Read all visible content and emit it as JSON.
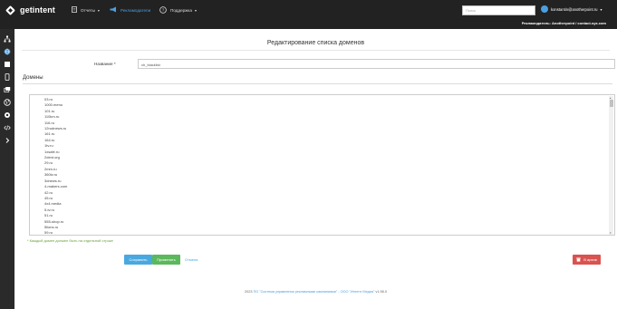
{
  "header": {
    "logo_text": "getintent",
    "nav": {
      "reports": "Отчеты",
      "advertisers": "Рекламодатели",
      "support": "Поддержка"
    },
    "search_placeholder": "Поиск",
    "user_email": "konstantin@anotherpoint.ru"
  },
  "subheader": {
    "advertiser_text": "Рекламодатель: Anotherpoint / contact-sys.com"
  },
  "sidebar": {
    "icons": [
      "sitemap-icon",
      "globe-icon",
      "square-icon",
      "phone-icon",
      "layers-icon",
      "globe-alt-icon",
      "settings-icon",
      "code-icon",
      "chevron-right-icon"
    ]
  },
  "page": {
    "title": "Редактирование списка доменов",
    "name_label": "Название",
    "name_required": "*",
    "name_value": "ch_blacklist",
    "domains_heading": "Домены",
    "domains": [
      "03.ru",
      "1000.menu",
      "101.ru",
      "110km.ru",
      "116.ru",
      "12rudnews.ru",
      "161.ru",
      "164.ru",
      "1tv.ru",
      "1xsafe.ru",
      "2dent.org",
      "29.ru",
      "2mm.ru",
      "360tv.ru",
      "3dnews.ru",
      "4-makers.com",
      "42.ru",
      "45.ru",
      "4x4.media",
      "5-tv.ru",
      "51.ru",
      "555-shop.ru",
      "5lions.ru",
      "59.ru",
      "63.ru"
    ],
    "hint": "* Каждый домен должен быть на отдельной строке"
  },
  "buttons": {
    "save": "Сохранить",
    "apply": "Применить",
    "cancel": "Отмена",
    "archive": "В архив"
  },
  "footer": {
    "prefix": "2023",
    "link": "ПО \"Система управления рекламными кампаниями\" - ООО \"Интент Медиа\"",
    "suffix": "v1.98.0"
  },
  "colors": {
    "topbar": "#222222",
    "accent": "#4a9fe0",
    "save": "#4aa8e0",
    "apply": "#5cb85c",
    "archive": "#d9534f",
    "hint": "#6ba03a"
  }
}
